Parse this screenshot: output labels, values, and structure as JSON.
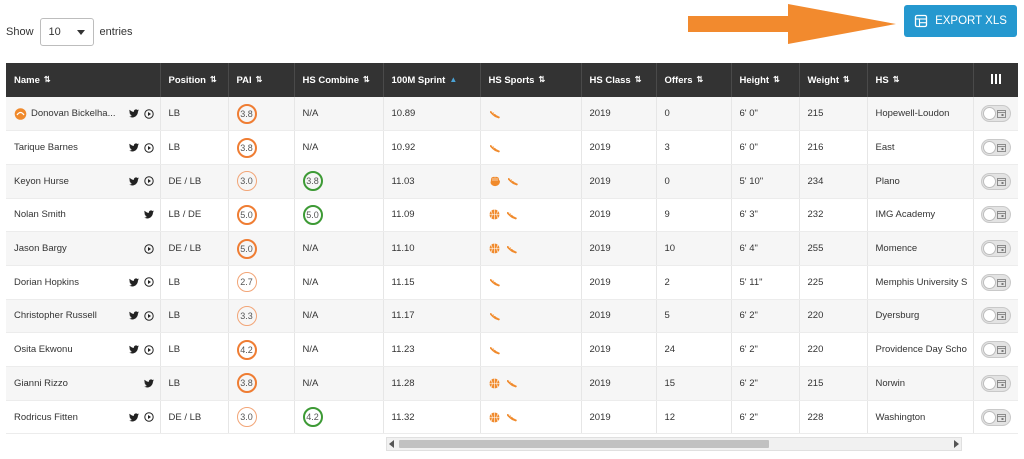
{
  "controls": {
    "show_label": "Show",
    "entries_value": "10",
    "entries_label": "entries",
    "export_label": "EXPORT XLS"
  },
  "colors": {
    "header_bg": "#333333",
    "export_bg": "#2598cf",
    "arrow": "#f28a2e",
    "pai_ring": "#ef7d33",
    "combine_ring": "#3d9a35"
  },
  "table": {
    "columns": [
      "Name",
      "Position",
      "PAI",
      "HS Combine",
      "100M Sprint",
      "HS Sports",
      "HS Class",
      "Offers",
      "Height",
      "Weight",
      "HS"
    ],
    "column_toggle_icon": "columns-icon",
    "rows": [
      {
        "name": "Donovan Bickelha...",
        "twitter": true,
        "video": true,
        "badge": true,
        "position": "LB",
        "pai": "3.8",
        "combine": "N/A",
        "sprint": "10.89",
        "sports": [
          "track"
        ],
        "hs_class": "2019",
        "offers": "0",
        "height": "6' 0\"",
        "weight": "215",
        "hs": "Hopewell-Loudon"
      },
      {
        "name": "Tarique Barnes",
        "twitter": true,
        "video": true,
        "badge": false,
        "position": "LB",
        "pai": "3.8",
        "combine": "N/A",
        "sprint": "10.92",
        "sports": [
          "track"
        ],
        "hs_class": "2019",
        "offers": "3",
        "height": "6' 0\"",
        "weight": "216",
        "hs": "East"
      },
      {
        "name": "Keyon Hurse",
        "twitter": true,
        "video": true,
        "badge": false,
        "position": "DE / LB",
        "pai": "3.0",
        "combine": "3.8",
        "sprint": "11.03",
        "sports": [
          "baseball",
          "track"
        ],
        "hs_class": "2019",
        "offers": "0",
        "height": "5' 10\"",
        "weight": "234",
        "hs": "Plano"
      },
      {
        "name": "Nolan Smith",
        "twitter": true,
        "video": false,
        "badge": false,
        "position": "LB / DE",
        "pai": "5.0",
        "combine": "5.0",
        "sprint": "11.09",
        "sports": [
          "basketball",
          "track"
        ],
        "hs_class": "2019",
        "offers": "9",
        "height": "6' 3\"",
        "weight": "232",
        "hs": "IMG Academy"
      },
      {
        "name": "Jason Bargy",
        "twitter": false,
        "video": true,
        "badge": false,
        "position": "DE / LB",
        "pai": "5.0",
        "combine": "N/A",
        "sprint": "11.10",
        "sports": [
          "basketball",
          "track"
        ],
        "hs_class": "2019",
        "offers": "10",
        "height": "6' 4\"",
        "weight": "255",
        "hs": "Momence"
      },
      {
        "name": "Dorian Hopkins",
        "twitter": true,
        "video": true,
        "badge": false,
        "position": "LB",
        "pai": "2.7",
        "combine": "N/A",
        "sprint": "11.15",
        "sports": [
          "track"
        ],
        "hs_class": "2019",
        "offers": "2",
        "height": "5' 11\"",
        "weight": "225",
        "hs": "Memphis University S"
      },
      {
        "name": "Christopher Russell",
        "twitter": true,
        "video": true,
        "badge": false,
        "position": "LB",
        "pai": "3.3",
        "combine": "N/A",
        "sprint": "11.17",
        "sports": [
          "track"
        ],
        "hs_class": "2019",
        "offers": "5",
        "height": "6' 2\"",
        "weight": "220",
        "hs": "Dyersburg"
      },
      {
        "name": "Osita Ekwonu",
        "twitter": true,
        "video": true,
        "badge": false,
        "position": "LB",
        "pai": "4.2",
        "combine": "N/A",
        "sprint": "11.23",
        "sports": [
          "track"
        ],
        "hs_class": "2019",
        "offers": "24",
        "height": "6' 2\"",
        "weight": "220",
        "hs": "Providence Day Scho"
      },
      {
        "name": "Gianni Rizzo",
        "twitter": true,
        "video": false,
        "badge": false,
        "position": "LB",
        "pai": "3.8",
        "combine": "N/A",
        "sprint": "11.28",
        "sports": [
          "basketball",
          "track"
        ],
        "hs_class": "2019",
        "offers": "15",
        "height": "6' 2\"",
        "weight": "215",
        "hs": "Norwin"
      },
      {
        "name": "Rodricus Fitten",
        "twitter": true,
        "video": true,
        "badge": false,
        "position": "DE / LB",
        "pai": "3.0",
        "combine": "4.2",
        "sprint": "11.32",
        "sports": [
          "basketball",
          "track"
        ],
        "hs_class": "2019",
        "offers": "12",
        "height": "6' 2\"",
        "weight": "228",
        "hs": "Washington"
      }
    ]
  }
}
